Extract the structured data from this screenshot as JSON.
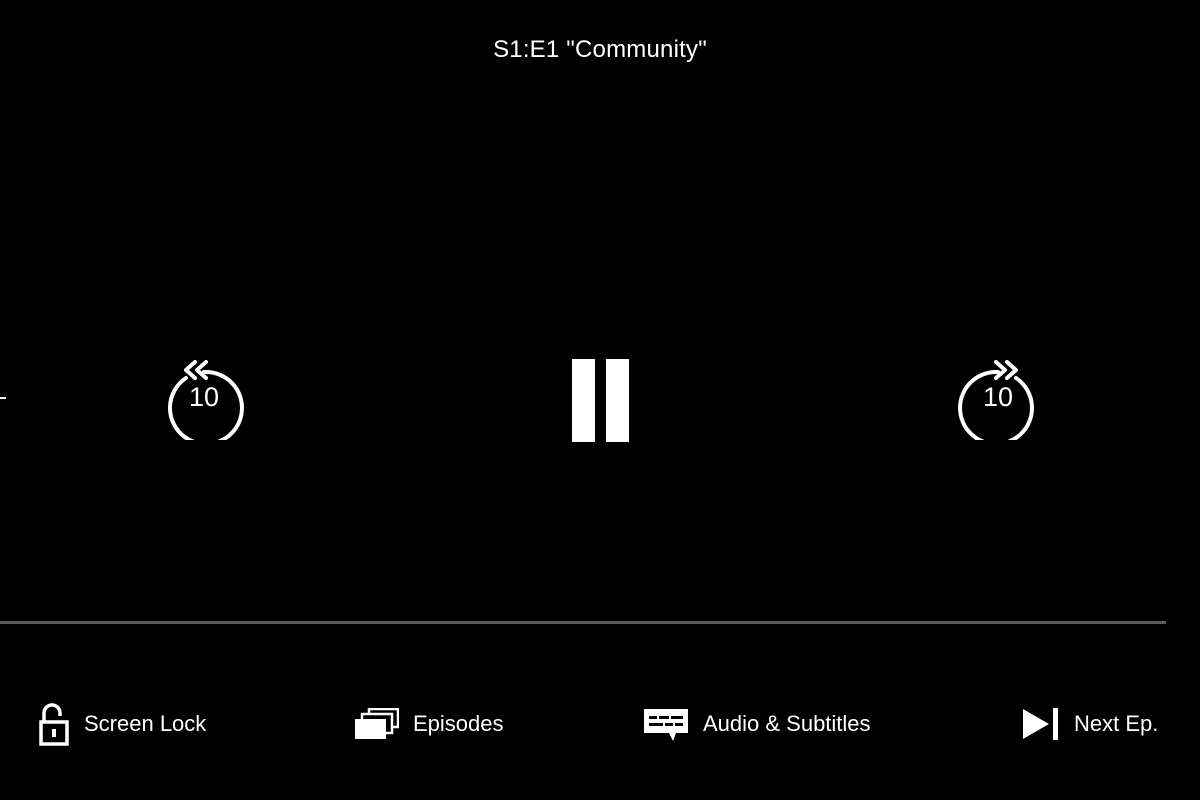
{
  "player": {
    "episode_title": "S1:E1 \"Community\"",
    "rewind_seconds": "10",
    "forward_seconds": "10",
    "progress_fraction": 0
  },
  "controls": {
    "screen_lock": "Screen Lock",
    "episodes": "Episodes",
    "audio_subtitles": "Audio & Subtitles",
    "next_episode": "Next Ep."
  },
  "icons": {
    "rewind": "rewind-10-icon",
    "pause": "pause-icon",
    "forward": "forward-10-icon",
    "lock": "unlocked-padlock-icon",
    "episodes": "stacked-cards-icon",
    "subtitles": "speech-bubble-icon",
    "next": "skip-next-icon"
  },
  "colors": {
    "background": "#000000",
    "foreground": "#ffffff",
    "track": "#5a5a5a",
    "progress": "#e50914"
  }
}
